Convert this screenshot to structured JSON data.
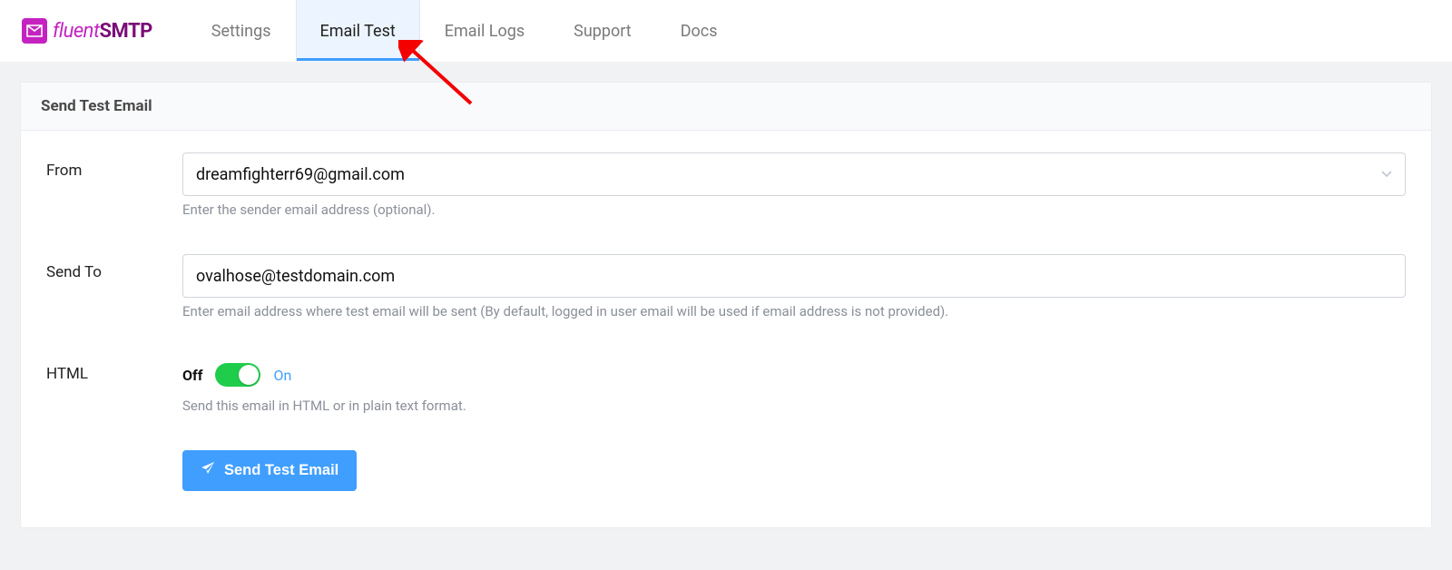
{
  "brand": {
    "fluent": "fluent",
    "smtp": "SMTP"
  },
  "nav": {
    "settings": "Settings",
    "email_test": "Email Test",
    "email_logs": "Email Logs",
    "support": "Support",
    "docs": "Docs"
  },
  "panel": {
    "title": "Send Test Email"
  },
  "fields": {
    "from": {
      "label": "From",
      "value": "dreamfighterr69@gmail.com",
      "help": "Enter the sender email address (optional)."
    },
    "send_to": {
      "label": "Send To",
      "value": "ovalhose@testdomain.com",
      "help": "Enter email address where test email will be sent (By default, logged in user email will be used if email address is not provided)."
    },
    "html": {
      "label": "HTML",
      "off": "Off",
      "on": "On",
      "help": "Send this email in HTML or in plain text format."
    }
  },
  "button": {
    "send": "Send Test Email"
  },
  "colors": {
    "accent": "#409EFF",
    "brand": "#c423c1",
    "switch_on": "#1fcd4b"
  }
}
